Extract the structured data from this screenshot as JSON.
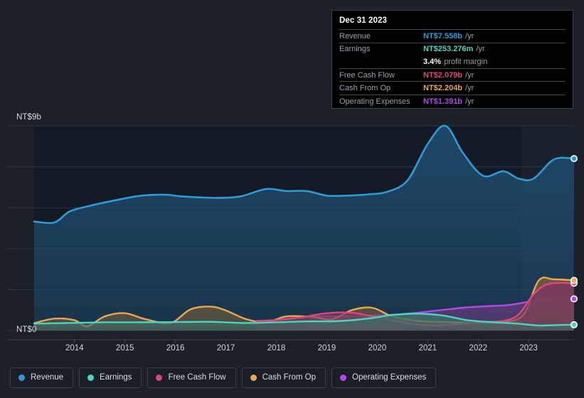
{
  "tooltip": {
    "title": "Dec 31 2023",
    "rows": [
      {
        "label": "Revenue",
        "value": "NT$7.558b",
        "unit": "/yr",
        "color": "#2e9bd6"
      },
      {
        "label": "Earnings",
        "value": "NT$253.276m",
        "unit": "/yr",
        "color": "#4ad5c0"
      },
      {
        "label": "Free Cash Flow",
        "value": "NT$2.079b",
        "unit": "/yr",
        "color": "#e0457f"
      },
      {
        "label": "Cash From Op",
        "value": "NT$2.204b",
        "unit": "/yr",
        "color": "#e8a84f"
      },
      {
        "label": "Operating Expenses",
        "value": "NT$1.391b",
        "unit": "/yr",
        "color": "#b24ae8"
      }
    ],
    "margin_value": "3.4%",
    "margin_label": "profit margin"
  },
  "legend": {
    "items": [
      {
        "label": "Revenue",
        "color": "#2e9bd6"
      },
      {
        "label": "Earnings",
        "color": "#4ad5c0"
      },
      {
        "label": "Free Cash Flow",
        "color": "#d6457f"
      },
      {
        "label": "Cash From Op",
        "color": "#e8a84f"
      },
      {
        "label": "Operating Expenses",
        "color": "#b24ae8"
      }
    ]
  },
  "chart_data": {
    "type": "area",
    "title": "",
    "xlabel": "",
    "ylabel": "",
    "grid": true,
    "legend_position": "bottom",
    "y_axis": {
      "top_label": "NT$9b",
      "zero_label": "NT$0",
      "ylim": [
        0,
        9
      ],
      "gridlines": [
        0,
        1.8,
        3.6,
        5.4,
        7.2,
        9.0
      ]
    },
    "x_axis": {
      "ticks": [
        "2014",
        "2015",
        "2016",
        "2017",
        "2018",
        "2019",
        "2020",
        "2021",
        "2022",
        "2023"
      ],
      "xlim": [
        2013.2,
        2023.9
      ]
    },
    "series": [
      {
        "name": "Revenue",
        "color": "#2e9bd6",
        "fill": "#1d4a6b",
        "x": [
          2013.2,
          2013.6,
          2013.9,
          2014.3,
          2014.8,
          2015.3,
          2015.8,
          2016.1,
          2016.5,
          2016.9,
          2017.3,
          2017.8,
          2018.2,
          2018.6,
          2019.0,
          2019.4,
          2019.8,
          2020.2,
          2020.6,
          2021.0,
          2021.35,
          2021.7,
          2022.1,
          2022.5,
          2022.8,
          2023.1,
          2023.5,
          2023.9
        ],
        "y": [
          4.79,
          4.75,
          5.23,
          5.48,
          5.72,
          5.92,
          5.97,
          5.9,
          5.85,
          5.83,
          5.9,
          6.22,
          6.13,
          6.13,
          5.93,
          5.93,
          5.98,
          6.1,
          6.6,
          8.2,
          9.0,
          7.8,
          6.8,
          7.0,
          6.68,
          6.68,
          7.52,
          7.558
        ]
      },
      {
        "name": "Earnings",
        "color": "#4ad5c0",
        "fill": "#3f6c68",
        "x": [
          2013.2,
          2013.9,
          2014.6,
          2015.3,
          2016.0,
          2016.7,
          2017.4,
          2018.0,
          2018.6,
          2019.2,
          2019.8,
          2020.3,
          2020.8,
          2021.3,
          2021.8,
          2022.3,
          2022.8,
          2023.2,
          2023.6,
          2023.9
        ],
        "y": [
          0.3,
          0.33,
          0.36,
          0.36,
          0.37,
          0.38,
          0.33,
          0.36,
          0.4,
          0.41,
          0.52,
          0.68,
          0.74,
          0.66,
          0.45,
          0.36,
          0.3,
          0.22,
          0.24,
          0.253
        ]
      },
      {
        "name": "Free Cash Flow",
        "color": "#e0457f",
        "fill": "#7a3a5e",
        "x": [
          2017.6,
          2018.0,
          2018.5,
          2019.0,
          2019.5,
          2019.9,
          2020.3,
          2020.8,
          2021.2,
          2021.7,
          2022.1,
          2022.5,
          2022.8,
          2023.1,
          2023.4,
          2023.9
        ],
        "y": [
          0.42,
          0.46,
          0.58,
          0.76,
          0.78,
          0.62,
          0.44,
          0.26,
          0.23,
          0.3,
          0.37,
          0.42,
          0.7,
          1.6,
          2.05,
          2.079
        ]
      },
      {
        "name": "Cash From Op",
        "color": "#e8a84f",
        "fill": "#6e5a3c",
        "x": [
          2013.2,
          2013.6,
          2014.0,
          2014.25,
          2014.6,
          2015.0,
          2015.4,
          2015.9,
          2016.3,
          2016.7,
          2017.0,
          2017.4,
          2017.8,
          2018.2,
          2018.7,
          2019.1,
          2019.5,
          2019.9,
          2020.3,
          2020.8,
          2021.2,
          2021.6,
          2022.0,
          2022.5,
          2022.9,
          2023.2,
          2023.5,
          2023.9
        ],
        "y": [
          0.32,
          0.52,
          0.45,
          0.18,
          0.62,
          0.76,
          0.5,
          0.33,
          0.93,
          1.05,
          0.88,
          0.5,
          0.36,
          0.62,
          0.6,
          0.49,
          0.9,
          1.0,
          0.62,
          0.42,
          0.38,
          0.36,
          0.32,
          0.36,
          0.7,
          2.2,
          2.25,
          2.204
        ]
      },
      {
        "name": "Operating Expenses",
        "color": "#b24ae8",
        "fill": "#5d3b78",
        "x": [
          2018.65,
          2019.2,
          2019.7,
          2020.2,
          2020.7,
          2021.2,
          2021.7,
          2022.1,
          2022.6,
          2023.0,
          2023.4,
          2023.9
        ],
        "y": [
          0.62,
          0.62,
          0.63,
          0.68,
          0.76,
          0.88,
          1.0,
          1.06,
          1.12,
          1.26,
          1.36,
          1.391
        ]
      }
    ]
  }
}
